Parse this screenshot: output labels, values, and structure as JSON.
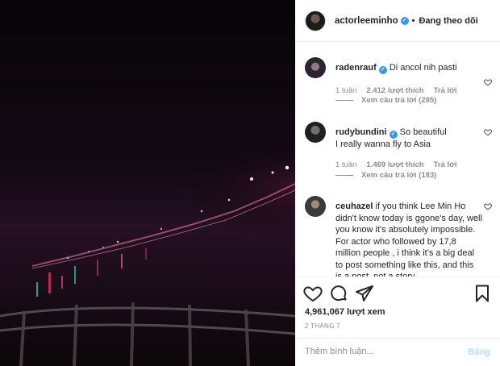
{
  "post": {
    "username": "actorleeminho",
    "follow_label": "Đang theo dõi",
    "views": "4,961,067 lượt xem",
    "date": "2 THÁNG 7"
  },
  "comments": [
    {
      "username": "radenrauf",
      "text": "Di ancol nih pasti",
      "time": "1 tuần",
      "likes": "2.412 lượt thích",
      "reply_label": "Trả lời",
      "view_replies": "Xem câu trả lời (285)"
    },
    {
      "username": "rudybundini",
      "text": "So beautiful\nI really wanna fly to Asia",
      "time": "1 tuần",
      "likes": "1.469 lượt thích",
      "reply_label": "Trả lời",
      "view_replies": "Xem câu trả lời (183)"
    },
    {
      "username": "ceuhazel",
      "text": "if you think Lee Min Ho didn't know today is ggone's day, well you know it's absolutely impossible. For actor who followed by 17,8 million people , i think it's a big deal to post something like this, and this is a post, not a story"
    }
  ],
  "add_comment": {
    "placeholder": "Thêm bình luận...",
    "post_label": "Đăng"
  },
  "icons": {
    "like": "heart-icon",
    "comment": "comment-icon",
    "share": "share-icon",
    "save": "bookmark-icon",
    "verified": "verified-badge-icon"
  },
  "colors": {
    "verified_blue": "#3897f0",
    "post_button_disabled": "#b2dffc",
    "secondary_text": "#8e8e8e"
  }
}
